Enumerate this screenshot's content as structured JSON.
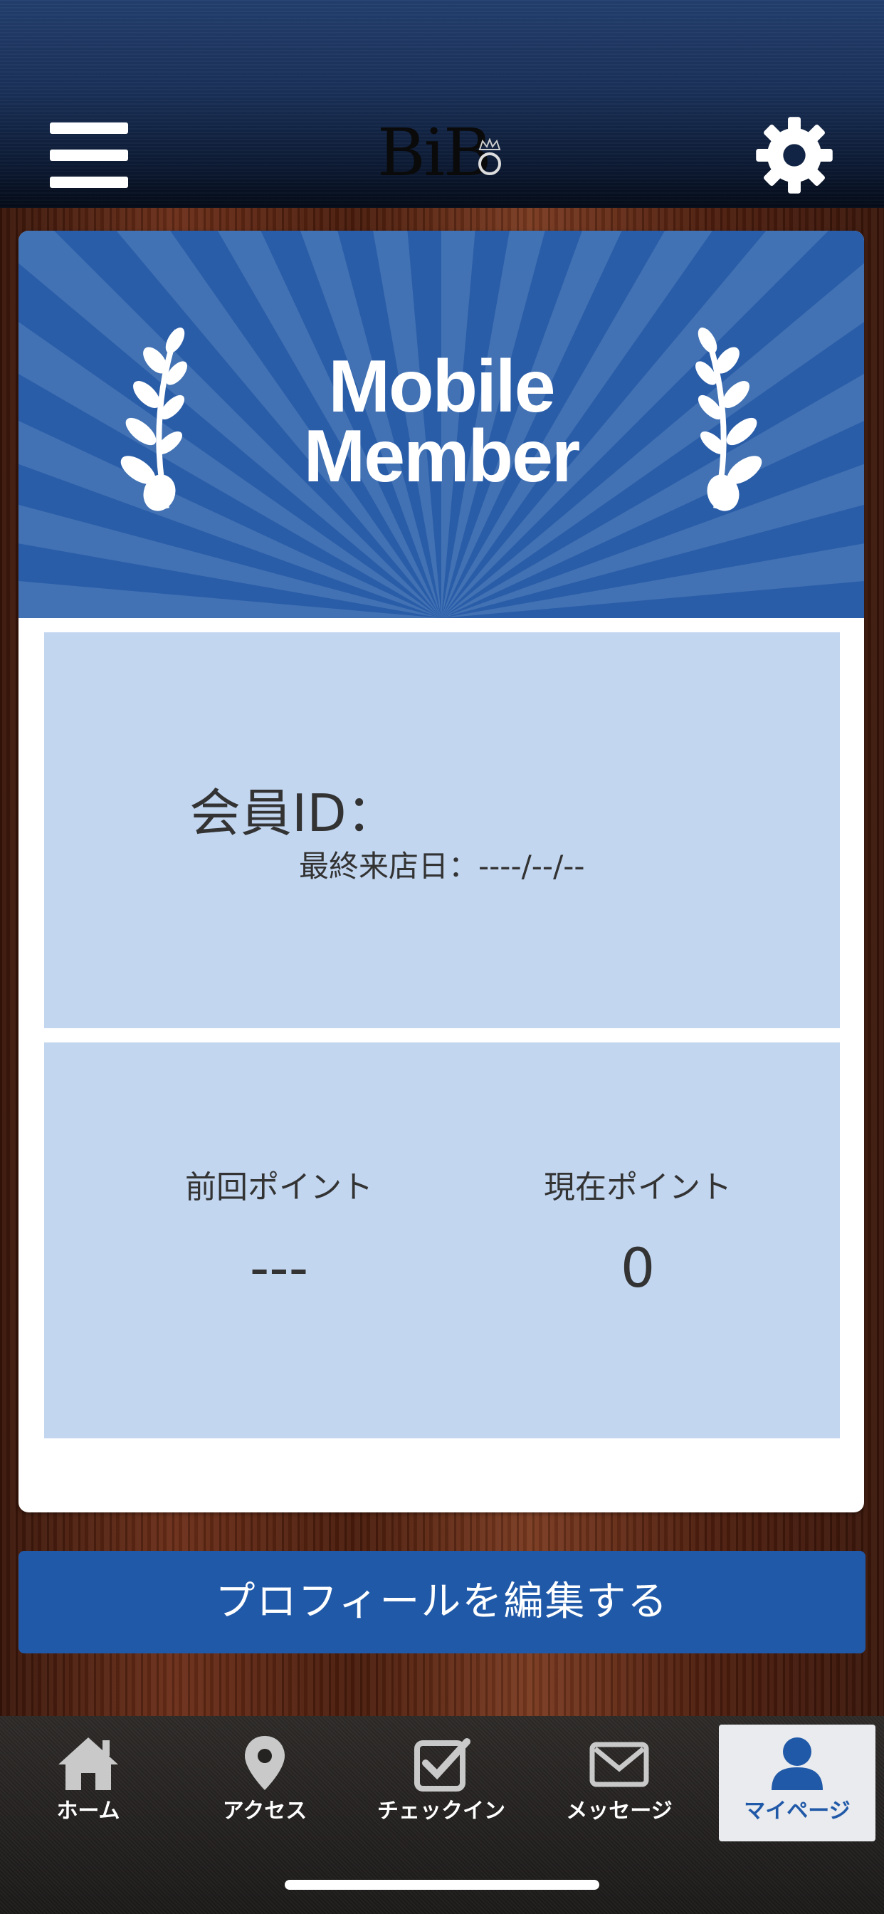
{
  "header": {
    "logo_text": "BiB",
    "menu_icon": "hamburger-menu-icon",
    "settings_icon": "gear-icon"
  },
  "banner": {
    "title_line1": "Mobile",
    "title_line2": "Member",
    "color": "#2a5da8"
  },
  "member": {
    "id_label": "会員ID：",
    "last_visit_label": "最終来店日：----/--/--"
  },
  "points": {
    "previous_label": "前回ポイント",
    "previous_value": "---",
    "current_label": "現在ポイント",
    "current_value": "0"
  },
  "edit_profile_button": "プロフィールを編集する",
  "tabs": [
    {
      "label": "ホーム",
      "icon": "home-icon"
    },
    {
      "label": "アクセス",
      "icon": "map-pin-icon"
    },
    {
      "label": "チェックイン",
      "icon": "checkbox-icon"
    },
    {
      "label": "メッセージ",
      "icon": "envelope-icon"
    },
    {
      "label": "マイページ",
      "icon": "person-icon",
      "active": true
    }
  ],
  "colors": {
    "accent": "#2059a8",
    "panel": "#c2d6f0"
  }
}
